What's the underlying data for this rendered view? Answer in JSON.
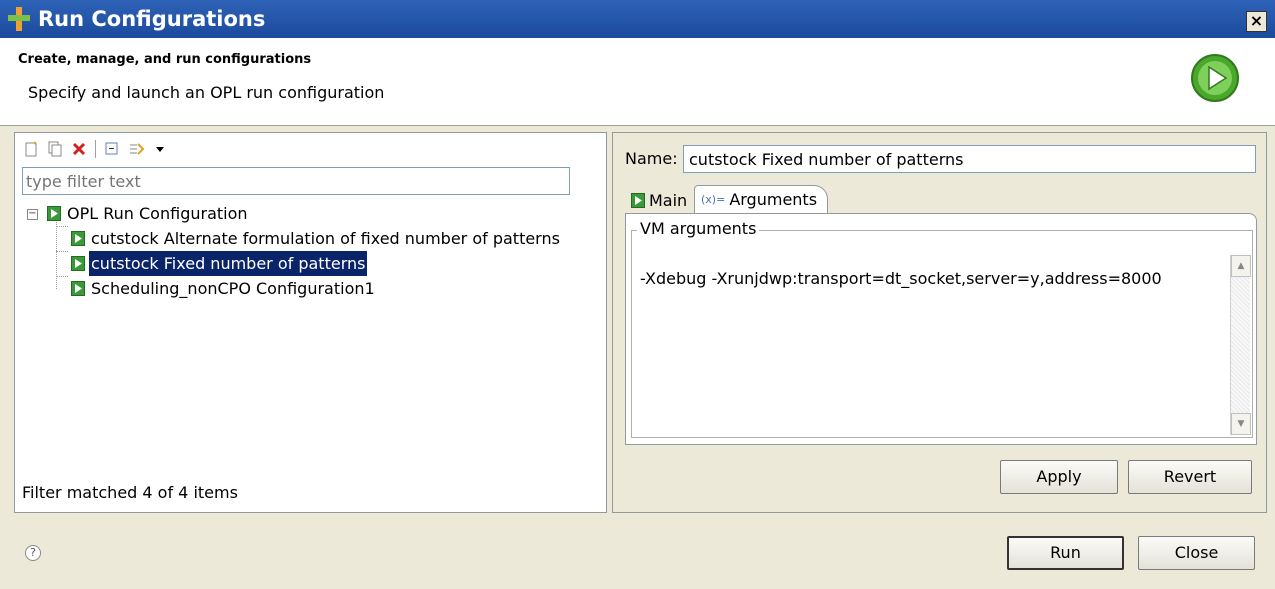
{
  "window": {
    "title": "Run Configurations",
    "close_glyph": "×"
  },
  "header": {
    "title": "Create, manage, and run configurations",
    "message": "Specify and launch an OPL run configuration",
    "icon": "run-icon"
  },
  "left": {
    "toolbar": [
      "new-configuration-icon",
      "duplicate-icon",
      "delete-icon",
      "collapse-all-icon",
      "filter-icon",
      "dropdown-arrow-icon"
    ],
    "filter_placeholder": "type filter text",
    "tree": {
      "root": "OPL Run Configuration",
      "children": [
        "cutstock Alternate formulation of fixed number of patterns",
        "cutstock Fixed number of patterns",
        "Scheduling_nonCPO Configuration1"
      ],
      "selected_index": 1
    },
    "status": "Filter matched 4 of 4 items"
  },
  "right": {
    "name_label": "Name:",
    "name_value": "cutstock Fixed number of patterns",
    "tabs": {
      "main": "Main",
      "arguments": "Arguments",
      "arguments_glyph": "(x)="
    },
    "vm_group_title": "VM arguments",
    "vm_arguments": "-Xdebug -Xrunjdwp:transport=dt_socket,server=y,address=8000",
    "apply": "Apply",
    "revert": "Revert"
  },
  "footer": {
    "help_glyph": "?",
    "run": "Run",
    "close": "Close"
  },
  "colors": {
    "titlebar": "#1c4a9c",
    "selection": "#0a246a",
    "config_icon": "#3a9a3a"
  }
}
